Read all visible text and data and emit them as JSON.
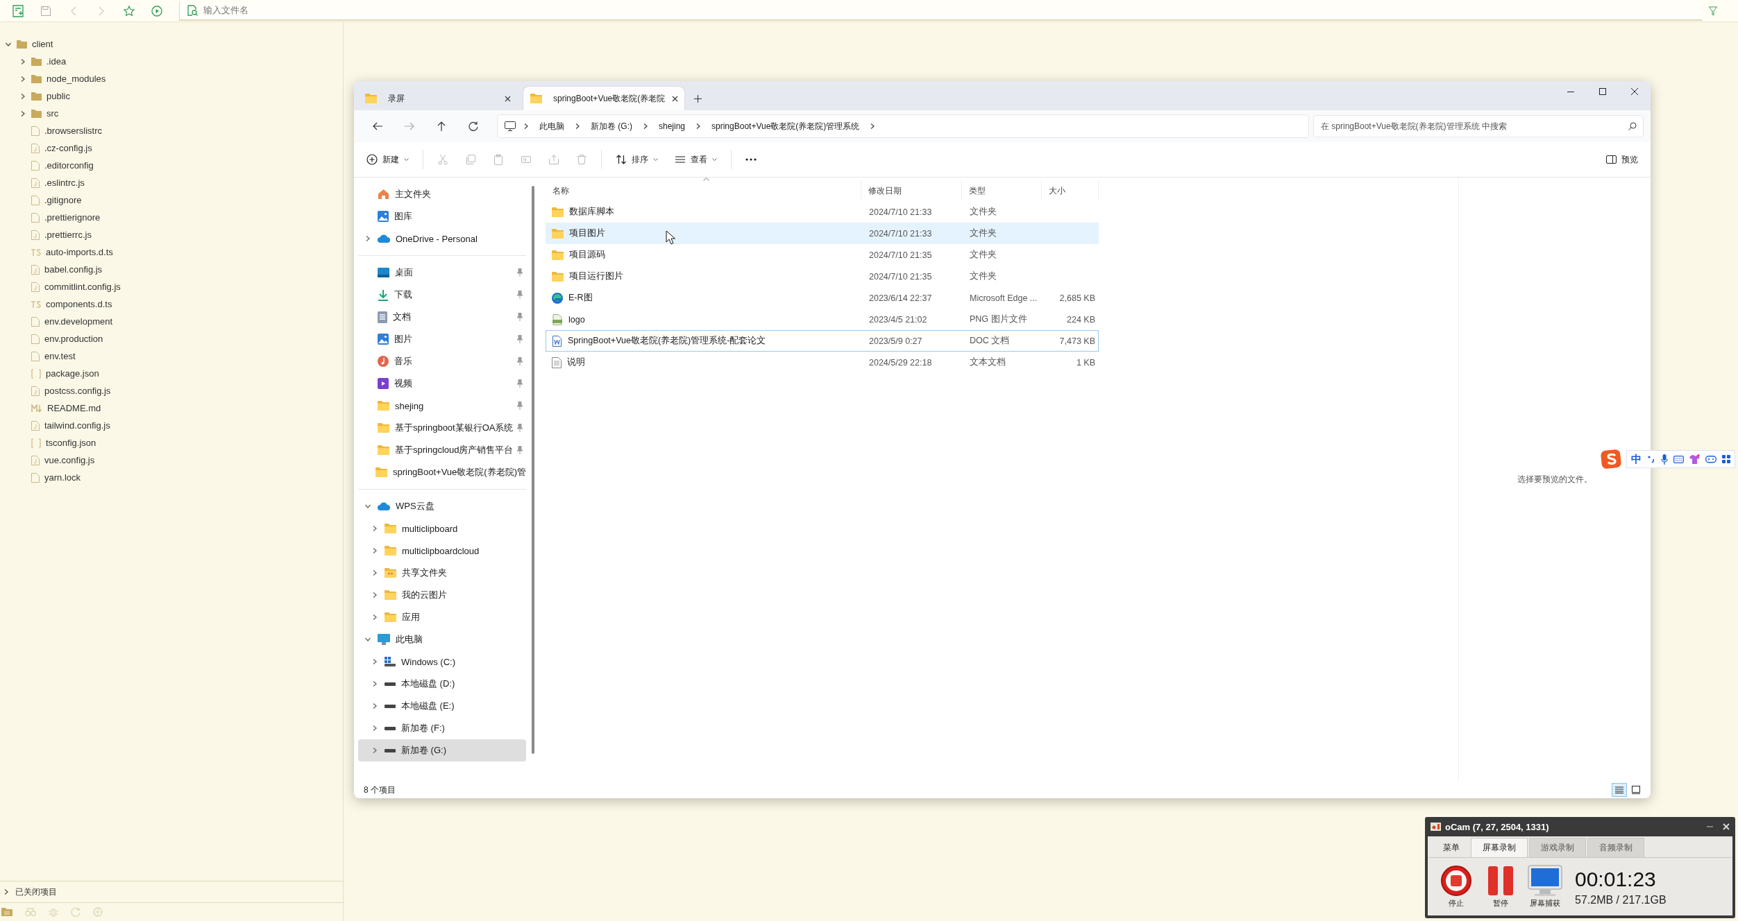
{
  "ide": {
    "search": {
      "placeholder": "输入文件名"
    },
    "tree": [
      {
        "name": "client",
        "kind": "folder",
        "expanded": true,
        "children": [
          {
            "name": ".idea",
            "kind": "folder",
            "expanded": false
          },
          {
            "name": "node_modules",
            "kind": "folder",
            "expanded": false
          },
          {
            "name": "public",
            "kind": "folder",
            "expanded": false
          },
          {
            "name": "src",
            "kind": "folder",
            "expanded": false
          },
          {
            "name": ".browserslistrc",
            "kind": "file"
          },
          {
            "name": ".cz-config.js",
            "kind": "js"
          },
          {
            "name": ".editorconfig",
            "kind": "file"
          },
          {
            "name": ".eslintrc.js",
            "kind": "js"
          },
          {
            "name": ".gitignore",
            "kind": "file"
          },
          {
            "name": ".prettierignore",
            "kind": "file"
          },
          {
            "name": ".prettierrc.js",
            "kind": "js"
          },
          {
            "name": "auto-imports.d.ts",
            "kind": "ts"
          },
          {
            "name": "babel.config.js",
            "kind": "js"
          },
          {
            "name": "commitlint.config.js",
            "kind": "js"
          },
          {
            "name": "components.d.ts",
            "kind": "ts"
          },
          {
            "name": "env.development",
            "kind": "file"
          },
          {
            "name": "env.production",
            "kind": "file"
          },
          {
            "name": "env.test",
            "kind": "file"
          },
          {
            "name": "package.json",
            "kind": "json"
          },
          {
            "name": "postcss.config.js",
            "kind": "js"
          },
          {
            "name": "README.md",
            "kind": "md"
          },
          {
            "name": "tailwind.config.js",
            "kind": "js"
          },
          {
            "name": "tsconfig.json",
            "kind": "json"
          },
          {
            "name": "vue.config.js",
            "kind": "js"
          },
          {
            "name": "yarn.lock",
            "kind": "file"
          }
        ]
      }
    ],
    "closed_projects": {
      "label": "已关闭项目",
      "expanded": false
    }
  },
  "explorer": {
    "tabs": [
      {
        "label": "录屏",
        "selected": false
      },
      {
        "label": "springBoot+Vue敬老院(养老院",
        "selected": true
      }
    ],
    "breadcrumbs": [
      "此电脑",
      "新加卷 (G:)",
      "shejing",
      "springBoot+Vue敬老院(养老院)管理系统"
    ],
    "search": {
      "placeholder": "在 springBoot+Vue敬老院(养老院)管理系统 中搜索"
    },
    "commands": [
      [
        {
          "kind": "new",
          "label": "新建",
          "disabled": false
        }
      ],
      [
        {
          "kind": "cut",
          "disabled": true
        },
        {
          "kind": "copy",
          "disabled": true
        },
        {
          "kind": "paste",
          "disabled": true
        },
        {
          "kind": "rename",
          "disabled": true
        },
        {
          "kind": "share",
          "disabled": true
        },
        {
          "kind": "delete",
          "disabled": true
        }
      ],
      [
        {
          "kind": "sort",
          "label": "排序",
          "disabled": false
        },
        {
          "kind": "view",
          "label": "查看",
          "disabled": false
        }
      ],
      [
        {
          "kind": "more",
          "disabled": false
        }
      ]
    ],
    "preview_button": "预览",
    "nav": [
      {
        "items": [
          {
            "label": "主文件夹",
            "kind": "home",
            "selected": false
          },
          {
            "label": "图库",
            "kind": "gallery",
            "selected": false
          },
          {
            "label": "OneDrive - Personal",
            "kind": "cloud",
            "expanded": false,
            "selected": false
          }
        ]
      },
      {
        "items": [
          {
            "label": "桌面",
            "kind": "desktop",
            "pinned": true,
            "selected": false
          },
          {
            "label": "下载",
            "kind": "download",
            "pinned": true,
            "selected": false
          },
          {
            "label": "文档",
            "kind": "docs",
            "pinned": true,
            "selected": false
          },
          {
            "label": "图片",
            "kind": "gallery",
            "pinned": true,
            "selected": false
          },
          {
            "label": "音乐",
            "kind": "music",
            "pinned": true,
            "selected": false
          },
          {
            "label": "视频",
            "kind": "video",
            "pinned": true,
            "selected": false
          },
          {
            "label": "shejing",
            "kind": "folder",
            "pinned": true,
            "selected": false
          },
          {
            "label": "基于springboot某银行OA系统",
            "kind": "folder",
            "pinned": true,
            "selected": false
          },
          {
            "label": "基于springcloud房产销售平台",
            "kind": "folder",
            "pinned": true,
            "selected": false
          },
          {
            "label": "springBoot+Vue敬老院(养老院)管",
            "kind": "folder",
            "pinned": false,
            "selected": false
          }
        ]
      },
      {
        "items": [
          {
            "label": "WPS云盘",
            "kind": "cloud",
            "expanded": true,
            "selected": false,
            "children": [
              {
                "label": "multiclipboard",
                "kind": "folder",
                "expanded": false,
                "selected": false
              },
              {
                "label": "multiclipboardcloud",
                "kind": "folder",
                "expanded": false,
                "selected": false
              },
              {
                "label": "共享文件夹",
                "kind": "shared",
                "expanded": false,
                "selected": false
              },
              {
                "label": "我的云图片",
                "kind": "folder",
                "expanded": false,
                "selected": false
              },
              {
                "label": "应用",
                "kind": "folder",
                "expanded": false,
                "selected": false
              }
            ]
          },
          {
            "label": "此电脑",
            "kind": "pc",
            "expanded": true,
            "selected": false,
            "children": [
              {
                "label": "Windows (C:)",
                "kind": "windows",
                "expanded": false,
                "selected": false
              },
              {
                "label": "本地磁盘 (D:)",
                "kind": "drive",
                "expanded": false,
                "selected": false
              },
              {
                "label": "本地磁盘 (E:)",
                "kind": "drive",
                "expanded": false,
                "selected": false
              },
              {
                "label": "新加卷 (F:)",
                "kind": "drive",
                "expanded": false,
                "selected": false
              },
              {
                "label": "新加卷 (G:)",
                "kind": "drive",
                "expanded": false,
                "selected": true
              }
            ]
          }
        ]
      }
    ],
    "columns": [
      {
        "label": "名称",
        "sorted": true
      },
      {
        "label": "修改日期",
        "sorted": false
      },
      {
        "label": "类型",
        "sorted": false
      },
      {
        "label": "大小",
        "sorted": false
      }
    ],
    "rows": [
      {
        "name": "数据库脚本",
        "modified": "2024/7/10 21:33",
        "type": "文件夹",
        "kind": "folder",
        "selected": false,
        "hovered": false,
        "focused": false
      },
      {
        "name": "项目图片",
        "modified": "2024/7/10 21:33",
        "type": "文件夹",
        "kind": "folder",
        "selected": false,
        "hovered": true,
        "focused": false
      },
      {
        "name": "项目源码",
        "modified": "2024/7/10 21:35",
        "type": "文件夹",
        "kind": "folder",
        "selected": false,
        "hovered": false,
        "focused": false
      },
      {
        "name": "项目运行图片",
        "modified": "2024/7/10 21:35",
        "type": "文件夹",
        "kind": "folder",
        "selected": false,
        "hovered": false,
        "focused": false
      },
      {
        "name": "E-R图",
        "modified": "2023/6/14 22:37",
        "type": "Microsoft Edge ...",
        "size": "2,685 KB",
        "kind": "edge",
        "selected": false,
        "hovered": false,
        "focused": false
      },
      {
        "name": "logo",
        "modified": "2023/4/5 21:02",
        "type": "PNG 图片文件",
        "size": "224 KB",
        "kind": "png",
        "selected": false,
        "hovered": false,
        "focused": false
      },
      {
        "name": "SpringBoot+Vue敬老院(养老院)管理系统-配套论文",
        "modified": "2023/5/9 0:27",
        "type": "DOC 文档",
        "size": "7,473 KB",
        "kind": "doc",
        "selected": false,
        "hovered": false,
        "focused": true
      },
      {
        "name": "说明",
        "modified": "2024/5/29 22:18",
        "type": "文本文档",
        "size": "1 KB",
        "kind": "txt",
        "selected": false,
        "hovered": false,
        "focused": false
      }
    ],
    "preview_message": "选择要预览的文件。",
    "status": "8 个项目",
    "views": [
      {
        "kind": "details",
        "selected": true
      },
      {
        "kind": "tiles",
        "selected": false
      }
    ]
  },
  "ime": {
    "mode": "中"
  },
  "ocam": {
    "title": "oCam (7, 27, 2504, 1331)",
    "tabs": [
      {
        "label": "菜单",
        "selected": false
      },
      {
        "label": "屏幕录制",
        "selected": true
      },
      {
        "label": "游戏录制",
        "selected": false
      },
      {
        "label": "音频录制",
        "selected": false
      }
    ],
    "buttons": [
      {
        "kind": "stop",
        "label": "停止"
      },
      {
        "kind": "pause",
        "label": "暂停"
      },
      {
        "kind": "capture",
        "label": "屏幕捕获"
      }
    ],
    "time": "00:01:23",
    "storage": "57.2MB / 217.1GB"
  }
}
